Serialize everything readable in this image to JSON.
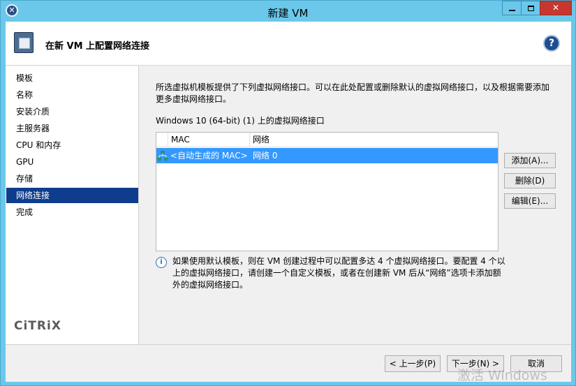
{
  "window": {
    "title": "新建 VM",
    "close_glyph": "✕",
    "min_label": "",
    "max_label": ""
  },
  "header": {
    "title": "在新 VM 上配置网络连接",
    "help_glyph": "?"
  },
  "sidebar": {
    "items": [
      {
        "label": "模板",
        "active": false
      },
      {
        "label": "名称",
        "active": false
      },
      {
        "label": "安装介质",
        "active": false
      },
      {
        "label": "主服务器",
        "active": false
      },
      {
        "label": "CPU 和内存",
        "active": false
      },
      {
        "label": "GPU",
        "active": false
      },
      {
        "label": "存储",
        "active": false
      },
      {
        "label": "网络连接",
        "active": true
      },
      {
        "label": "完成",
        "active": false
      }
    ],
    "logo_text": "CiTRiX"
  },
  "main": {
    "description": "所选虚拟机模板提供了下列虚拟网络接口。可以在此处配置或删除默认的虚拟网络接口，以及根据需要添加更多虚拟网络接口。",
    "interfaces_label": "Windows 10 (64-bit) (1) 上的虚拟网络接口",
    "table": {
      "columns": [
        "MAC",
        "网络"
      ],
      "rows": [
        {
          "mac": "<自动生成的 MAC>",
          "network": "网络 0",
          "selected": true
        }
      ]
    },
    "buttons": {
      "add": "添加(A)...",
      "delete": "删除(D)",
      "edit": "编辑(E)..."
    },
    "info_glyph": "i",
    "info_text": "如果使用默认模板，则在 VM 创建过程中可以配置多达 4 个虚拟网络接口。要配置 4 个以上的虚拟网络接口，请创建一个自定义模板，或者在创建新 VM 后从“网络”选项卡添加额外的虚拟网络接口。"
  },
  "footer": {
    "prev": "< 上一步(P)",
    "next": "下一步(N) >",
    "cancel": "取消"
  },
  "watermark": "激活 Windows",
  "colors": {
    "titlebar": "#6bc8ea",
    "selection": "#3399ff",
    "nav_active": "#0f3c8c",
    "close_button": "#c7372f"
  }
}
